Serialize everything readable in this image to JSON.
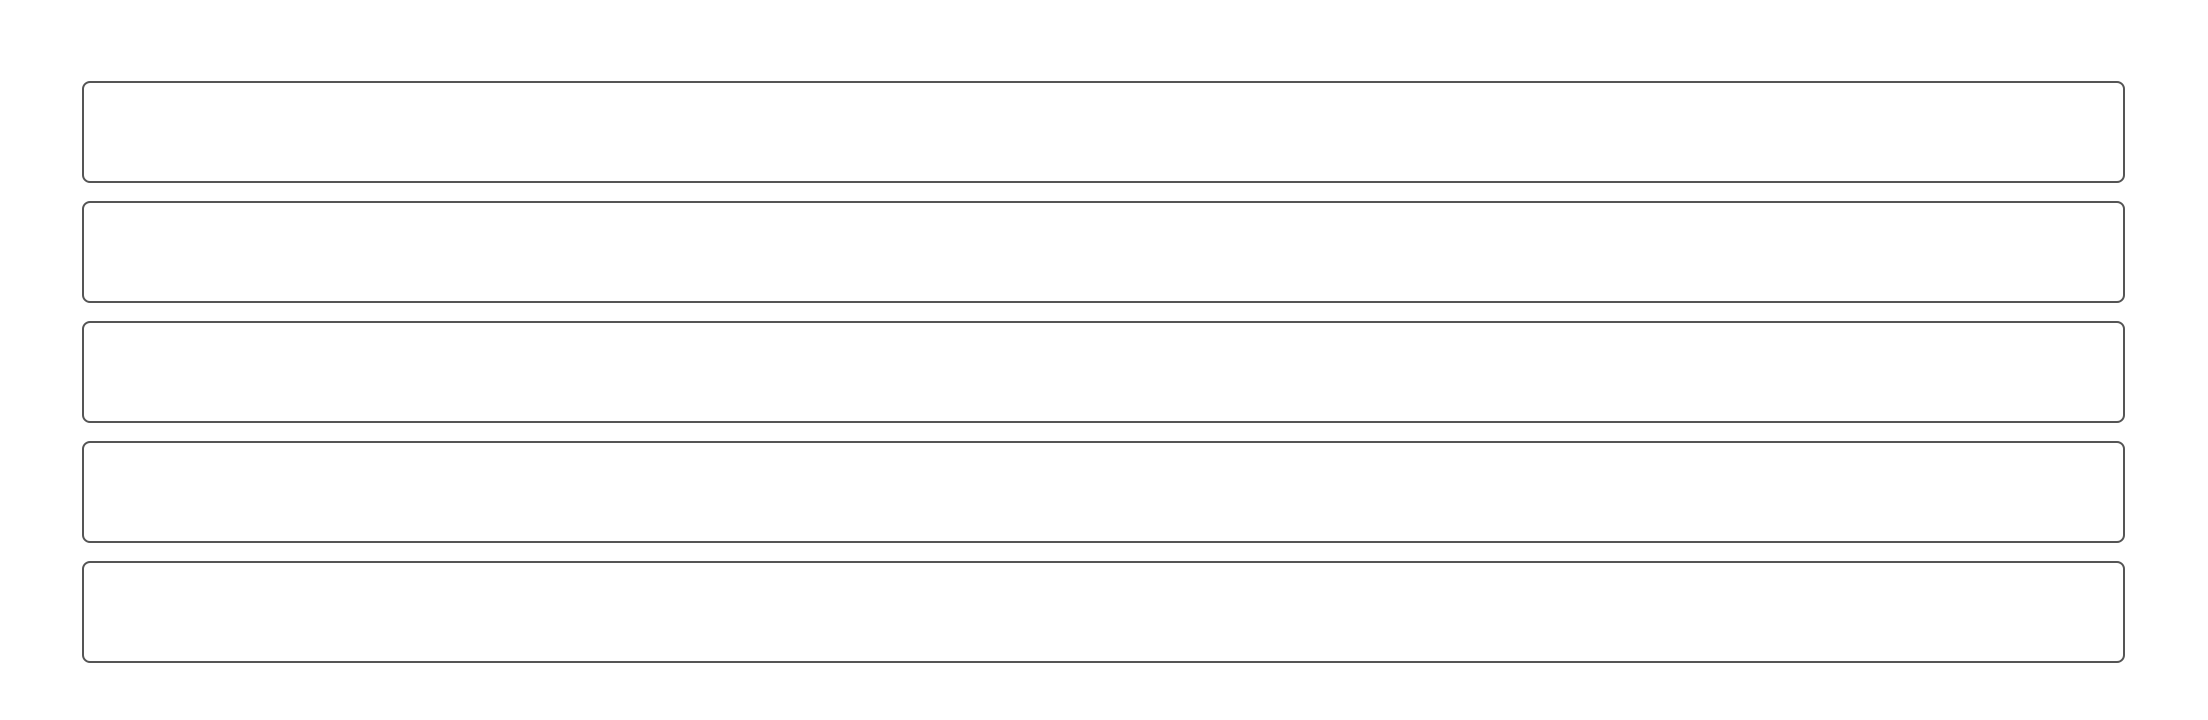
{
  "colors": {
    "background": "#ffffff",
    "border": "#555555"
  },
  "fields": [
    {
      "value": ""
    },
    {
      "value": ""
    },
    {
      "value": ""
    },
    {
      "value": ""
    },
    {
      "value": ""
    }
  ]
}
